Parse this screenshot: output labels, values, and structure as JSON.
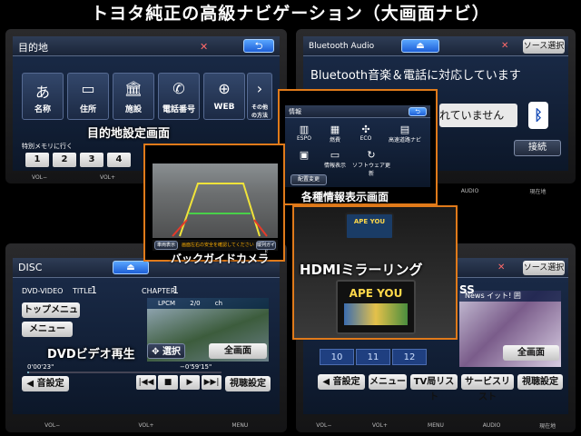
{
  "headline": "トヨタ純正の高級ナビゲーション（大画面ナビ）",
  "panel_dest": {
    "title": "目的地",
    "tiles": [
      {
        "icon": "あ",
        "label": "名称"
      },
      {
        "icon": "▭",
        "label": "住所"
      },
      {
        "icon": "🏛",
        "label": "施設"
      },
      {
        "icon": "✆",
        "label": "電話番号"
      },
      {
        "icon": "⊕",
        "label": "WEB"
      }
    ],
    "more_label": "その他\nの方法",
    "memory_label": "特別メモリに行く",
    "num_keys": [
      "1",
      "2",
      "3",
      "4"
    ],
    "caption": "目的地設定画面"
  },
  "panel_bt": {
    "title": "Bluetooth Audio",
    "source_button": "ソース選択",
    "message": "Bluetooth音楽＆電話に対応しています",
    "status": "れていません",
    "connect_button": "接続"
  },
  "panel_info": {
    "title": "情報",
    "icons": [
      "ESPO",
      "燃費",
      "ECO",
      "高速道路ナビ",
      "",
      "情報表示",
      "ソフトウェア更新"
    ],
    "config_button": "配置変更",
    "caption": "各種情報表示画面"
  },
  "panel_camera": {
    "notice": "画面左右の安全を確認してください",
    "left_button": "車両表示",
    "right_button": "縦列ガイド",
    "caption": "バックガイドカメラ"
  },
  "panel_hdmi": {
    "logo_text": "APE YOU",
    "caption": "HDMIミラーリング"
  },
  "panel_dvd": {
    "title": "DISC",
    "format": "DVD-VIDEO",
    "title_label": "TITLE",
    "title_no": "1",
    "chapter_label": "CHAPTER",
    "chapter_no": "1",
    "audio_info": "LPCM",
    "audio_ch": "2/0",
    "audio_unit": "ch",
    "top_menu": "トップメニュー",
    "menu": "メニュー",
    "select": "選択",
    "fullscreen": "全画面",
    "elapsed": "0'00'23\"",
    "remaining": "−0'59'15\"",
    "sound": "音設定",
    "view": "視聴設定",
    "caption": "DVDビデオ再生"
  },
  "panel_tv": {
    "source_button": "ソース選択",
    "channels": [
      "10",
      "11",
      "12"
    ],
    "news": "News イット! 囲",
    "fullscreen": "全画面",
    "sound": "音設定",
    "menu": "メニュー",
    "tv_list": "TV局リスト",
    "service_list": "サービスリスト",
    "view": "視聴設定",
    "ss_fragment": "SS"
  },
  "hard_buttons": [
    "VOL−",
    "VOL+",
    "MENU",
    "AUDIO",
    "現在地"
  ]
}
